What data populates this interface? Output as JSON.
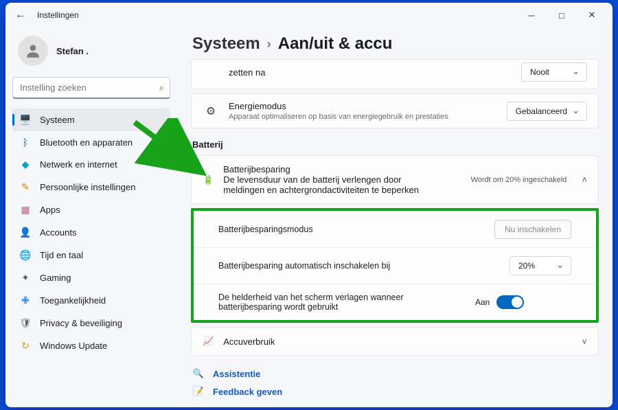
{
  "window": {
    "title": "Instellingen"
  },
  "profile": {
    "name": "Stefan ."
  },
  "search": {
    "placeholder": "Instelling zoeken"
  },
  "nav": [
    {
      "label": "Systeem",
      "icon": "🖥️",
      "cls": "c-blue",
      "name": "system",
      "active": true
    },
    {
      "label": "Bluetooth en apparaten",
      "icon": "ᛒ",
      "cls": "c-blue",
      "name": "bluetooth"
    },
    {
      "label": "Netwerk en internet",
      "icon": "◆",
      "cls": "c-teal",
      "name": "network"
    },
    {
      "label": "Persoonlijke instellingen",
      "icon": "✎",
      "cls": "c-orange",
      "name": "personalization"
    },
    {
      "label": "Apps",
      "icon": "▦",
      "cls": "c-pink",
      "name": "apps"
    },
    {
      "label": "Accounts",
      "icon": "👤",
      "cls": "c-green",
      "name": "accounts"
    },
    {
      "label": "Tijd en taal",
      "icon": "🌐",
      "cls": "c-globe",
      "name": "time-language"
    },
    {
      "label": "Gaming",
      "icon": "✦",
      "cls": "c-gray",
      "name": "gaming"
    },
    {
      "label": "Toegankelijkheid",
      "icon": "✙",
      "cls": "c-blue",
      "name": "accessibility"
    },
    {
      "label": "Privacy & beveiliging",
      "icon": "🛡",
      "cls": "c-gray",
      "name": "privacy"
    },
    {
      "label": "Windows Update",
      "icon": "↻",
      "cls": "c-yell",
      "name": "update"
    }
  ],
  "breadcrumb": {
    "parent": "Systeem",
    "current": "Aan/uit & accu"
  },
  "cards": {
    "sleep": {
      "title_line": "zetten na",
      "value": "Nooit"
    },
    "power_mode": {
      "title": "Energiemodus",
      "sub": "Apparaat optimaliseren op basis van energiegebruik en prestaties",
      "value": "Gebalanceerd"
    }
  },
  "battery_section": "Batterij",
  "saver": {
    "title": "Batterijbesparing",
    "sub": "De levensduur van de batterij verlengen door meldingen en achtergrondactiviteiten te beperken",
    "status": "Wordt om 20% ingeschakeld"
  },
  "saver_rows": {
    "mode": {
      "label": "Batterijbesparingsmodus",
      "button": "Nu inschakelen"
    },
    "auto": {
      "label": "Batterijbesparing automatisch inschakelen bij",
      "value": "20%"
    },
    "brightness": {
      "label": "De helderheid van het scherm verlagen wanneer batterijbesparing wordt gebruikt",
      "state": "Aan"
    }
  },
  "usage": {
    "title": "Accuverbruik"
  },
  "help": {
    "assist": "Assistentie",
    "feedback": "Feedback geven"
  }
}
